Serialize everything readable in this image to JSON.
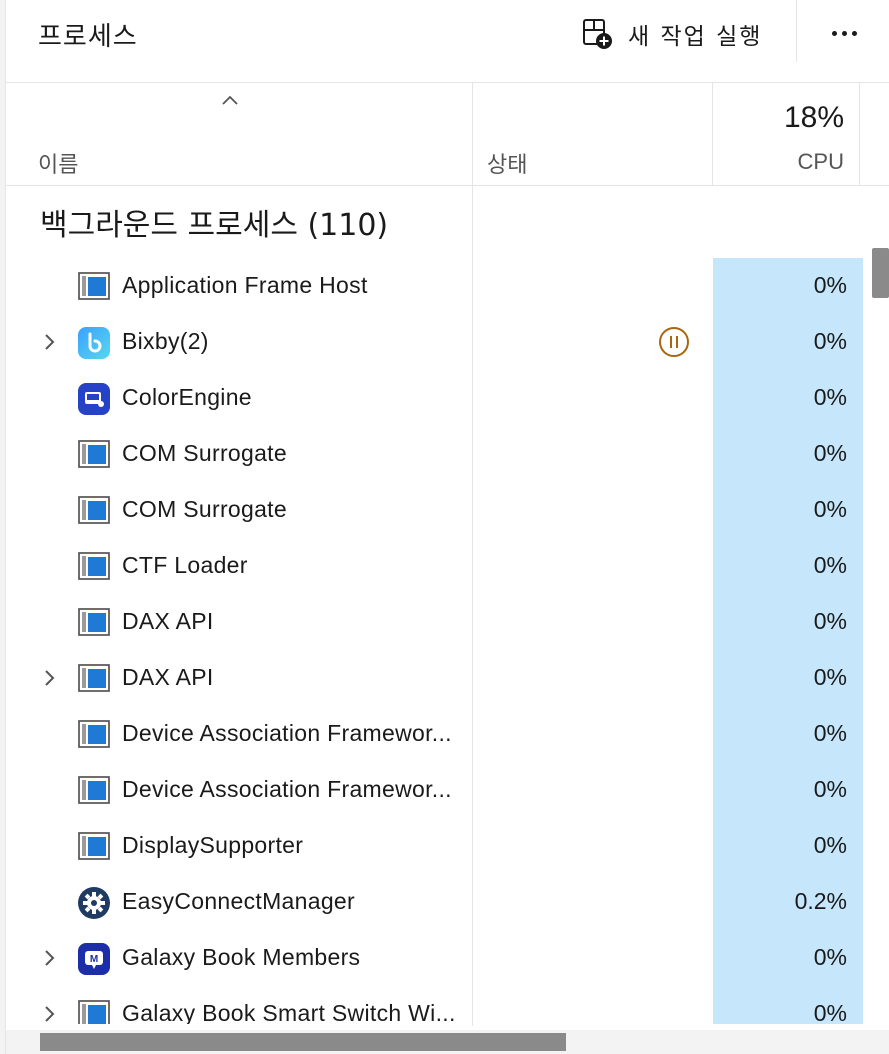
{
  "header": {
    "title": "프로세스",
    "new_task_label": "새 작업 실행",
    "more_label": "..."
  },
  "columns": {
    "name": "이름",
    "status": "상태",
    "cpu_total": "18%",
    "cpu": "CPU"
  },
  "group": {
    "title": "백그라운드 프로세스 (110)"
  },
  "rows": [
    {
      "name": "Application Frame Host",
      "icon": "window-icon",
      "expandable": false,
      "status": "",
      "cpu": "0%"
    },
    {
      "name": "Bixby(2)",
      "icon": "bixby-icon",
      "expandable": true,
      "status": "paused",
      "cpu": "0%"
    },
    {
      "name": "ColorEngine",
      "icon": "color-engine-icon",
      "expandable": false,
      "status": "",
      "cpu": "0%"
    },
    {
      "name": "COM Surrogate",
      "icon": "window-icon",
      "expandable": false,
      "status": "",
      "cpu": "0%"
    },
    {
      "name": "COM Surrogate",
      "icon": "window-icon",
      "expandable": false,
      "status": "",
      "cpu": "0%"
    },
    {
      "name": "CTF Loader",
      "icon": "window-icon",
      "expandable": false,
      "status": "",
      "cpu": "0%"
    },
    {
      "name": "DAX API",
      "icon": "window-icon",
      "expandable": false,
      "status": "",
      "cpu": "0%"
    },
    {
      "name": "DAX API",
      "icon": "window-icon",
      "expandable": true,
      "status": "",
      "cpu": "0%"
    },
    {
      "name": "Device Association Framewor...",
      "icon": "window-icon",
      "expandable": false,
      "status": "",
      "cpu": "0%"
    },
    {
      "name": "Device Association Framewor...",
      "icon": "window-icon",
      "expandable": false,
      "status": "",
      "cpu": "0%"
    },
    {
      "name": "DisplaySupporter",
      "icon": "window-icon",
      "expandable": false,
      "status": "",
      "cpu": "0%"
    },
    {
      "name": "EasyConnectManager",
      "icon": "gear-icon",
      "expandable": false,
      "status": "",
      "cpu": "0.2%"
    },
    {
      "name": "Galaxy Book Members",
      "icon": "members-icon",
      "expandable": true,
      "status": "",
      "cpu": "0%"
    },
    {
      "name": "Galaxy Book Smart Switch Wi...",
      "icon": "window-icon",
      "expandable": true,
      "status": "",
      "cpu": "0%"
    }
  ],
  "colors": {
    "cpu_highlight": "#c6e7fb",
    "paused_status": "#a9660e",
    "app_blue": "#1f7ad6"
  }
}
